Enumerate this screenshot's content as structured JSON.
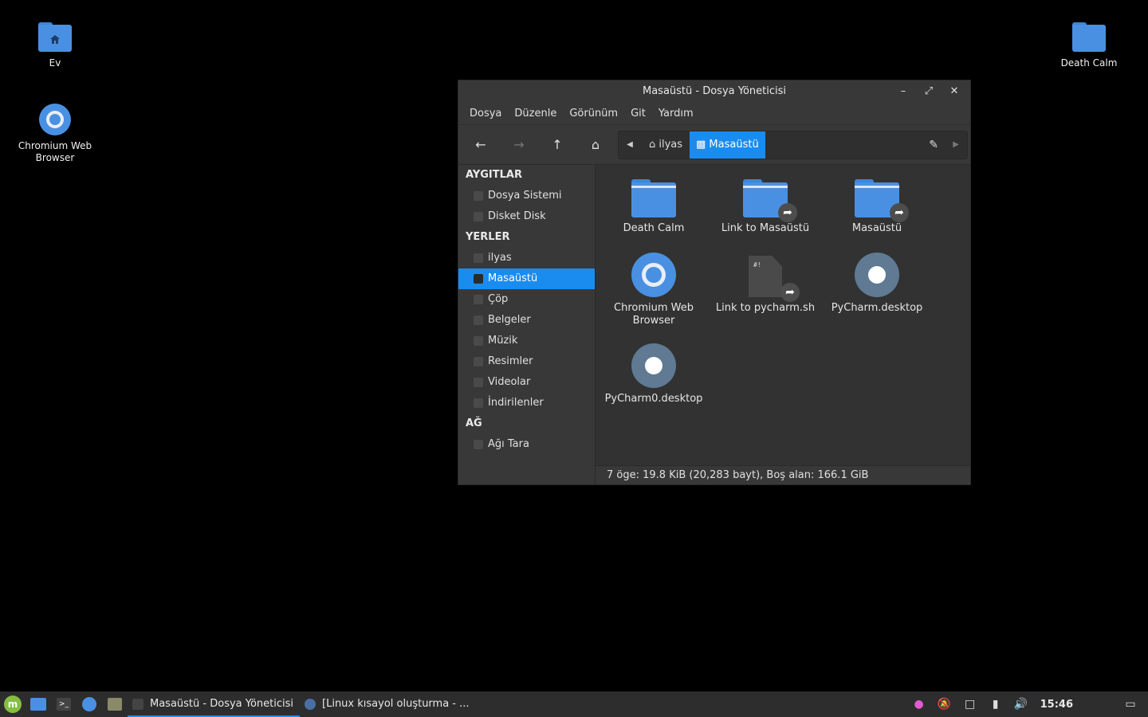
{
  "desktop": {
    "icons": [
      {
        "label": "Ev"
      },
      {
        "label": "Chromium Web Browser"
      },
      {
        "label": "Death Calm"
      }
    ]
  },
  "window": {
    "title": "Masaüstü - Dosya Yöneticisi",
    "menu": [
      "Dosya",
      "Düzenle",
      "Görünüm",
      "Git",
      "Yardım"
    ],
    "path": {
      "home": "ilyas",
      "current": "Masaüstü"
    },
    "sidebar": {
      "devices_header": "AYGITLAR",
      "devices": [
        "Dosya Sistemi",
        "Disket Disk"
      ],
      "places_header": "YERLER",
      "places": [
        "ilyas",
        "Masaüstü",
        "Çöp",
        "Belgeler",
        "Müzik",
        "Resimler",
        "Videolar",
        "İndirilenler"
      ],
      "network_header": "AĞ",
      "network": [
        "Ağı Tara"
      ]
    },
    "files": [
      {
        "name": "Death Calm",
        "icon": "folder-icon"
      },
      {
        "name": "Link to Masaüstü",
        "icon": "folder-link-icon"
      },
      {
        "name": "Masaüstü",
        "icon": "folder-link-icon"
      },
      {
        "name": "Chromium Web Browser",
        "icon": "chromium-icon"
      },
      {
        "name": "Link to pycharm.sh",
        "icon": "script-link-icon"
      },
      {
        "name": "PyCharm.desktop",
        "icon": "gear-icon"
      },
      {
        "name": "PyCharm0.desktop",
        "icon": "gear-icon"
      }
    ],
    "status": "7 öge: 19.8 KiB (20,283 bayt), Boş alan: 166.1 GiB"
  },
  "taskbar": {
    "tasks": [
      "Masaüstü - Dosya Yöneticisi",
      "[Linux kısayol oluşturma - ..."
    ],
    "clock": "15:46"
  },
  "colors": {
    "accent": "#1a8cf0",
    "folder": "#4a90e2"
  }
}
